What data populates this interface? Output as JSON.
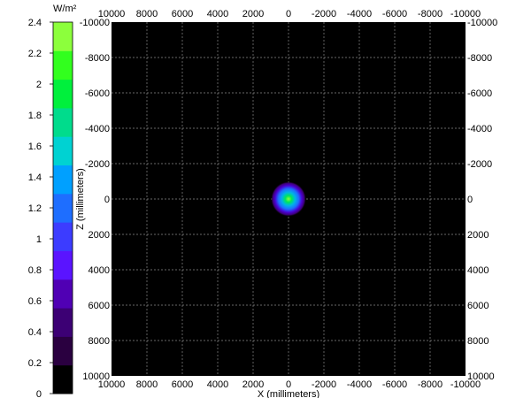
{
  "chart_data": {
    "type": "heatmap",
    "title": "",
    "xlabel": "X (millimeters)",
    "ylabel": "Z (millimeters)",
    "xlim": [
      10000,
      -10000
    ],
    "zlim": [
      -10000,
      10000
    ],
    "x_ticks": [
      "10000",
      "8000",
      "6000",
      "4000",
      "2000",
      "0",
      "-2000",
      "-4000",
      "-6000",
      "-8000",
      "-10000"
    ],
    "z_ticks": [
      "-10000",
      "-8000",
      "-6000",
      "-4000",
      "-2000",
      "0",
      "2000",
      "4000",
      "6000",
      "8000",
      "10000"
    ],
    "grid": true,
    "background_color": "#000000",
    "colorbar": {
      "unit": "W/m²",
      "range": [
        0,
        2.4
      ],
      "tick_labels": [
        "0",
        "0.2",
        "0.4",
        "0.6",
        "0.8",
        "1",
        "1.2",
        "1.4",
        "1.6",
        "1.8",
        "2",
        "2.2",
        "2.4"
      ],
      "colors": [
        "#000000",
        "#2a0040",
        "#3c0074",
        "#5000b4",
        "#5a14ff",
        "#3c3cff",
        "#1e6eff",
        "#00a0ff",
        "#00d2d2",
        "#00dc8c",
        "#00f03c",
        "#32ff1e",
        "#8cff3c"
      ]
    },
    "spot": {
      "center_x": 0,
      "center_z": 0,
      "radius_mm": 1000,
      "peak_value": 2.4
    }
  }
}
